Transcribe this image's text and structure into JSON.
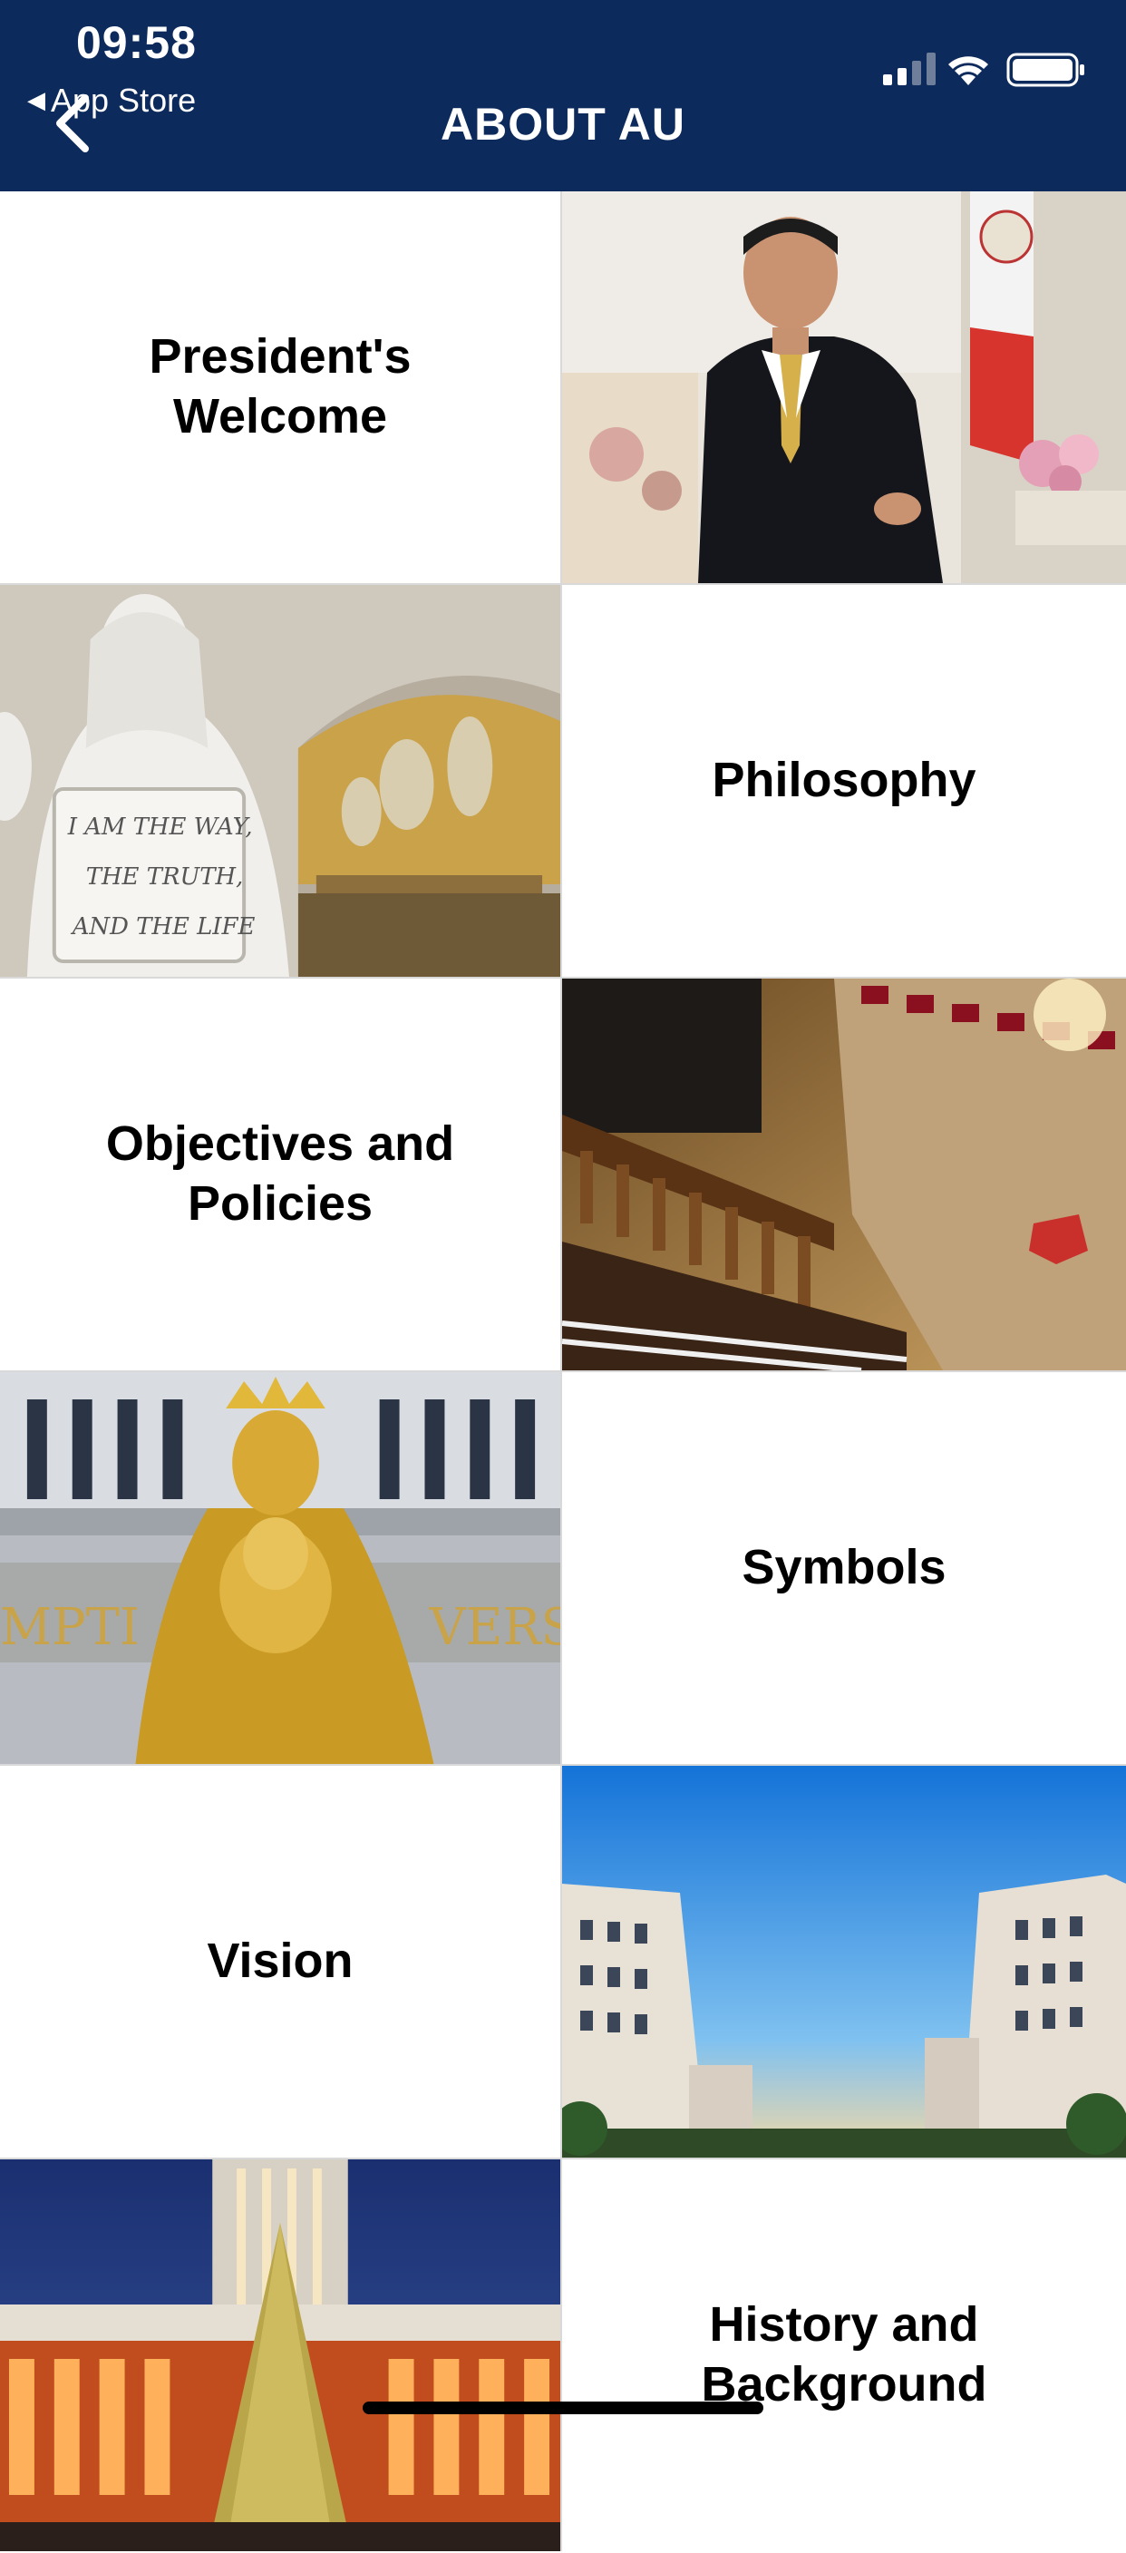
{
  "status_bar": {
    "time": "09:58",
    "back_app_label": "App Store"
  },
  "header": {
    "title": "ABOUT AU"
  },
  "items": [
    {
      "label": "President's Welcome"
    },
    {
      "label": "Philosophy"
    },
    {
      "label": "Objectives and Policies"
    },
    {
      "label": "Symbols"
    },
    {
      "label": "Vision"
    },
    {
      "label": "History and Background"
    }
  ],
  "colors": {
    "header_bg": "#0c2a5b",
    "text": "#000000",
    "divider": "#d9d9d9"
  }
}
